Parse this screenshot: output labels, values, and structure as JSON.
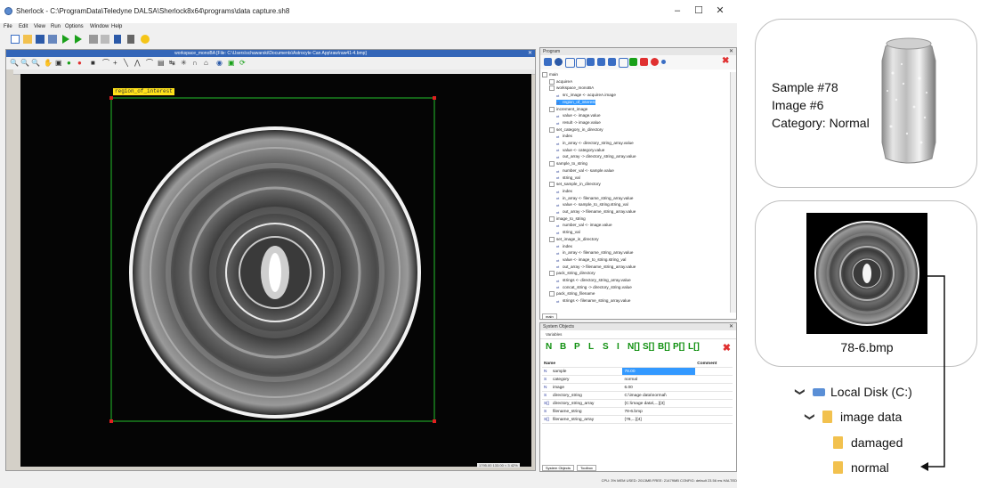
{
  "window": {
    "title": "Sherlock - C:\\ProgramData\\Teledyne DALSA\\Sherlock8x64\\programs\\data capture.sh8",
    "minimize": "–",
    "maximize": "☐",
    "close": "✕"
  },
  "menu": [
    "File",
    "Edit",
    "View",
    "Run",
    "Options",
    "Window",
    "Help"
  ],
  "image_window": {
    "title": "workspace_monoBA [File: C:\\Users\\schawarski\\Documents\\Astrocyte Can App\\raw\\raw41-4.bmp]",
    "roi_label": "region_of_interest",
    "status": "1795.00 133.00 < 3  42%"
  },
  "program": {
    "title": "Program",
    "tab": "main",
    "tree": [
      {
        "indent": 0,
        "label": "main"
      },
      {
        "indent": 1,
        "label": "acquireA"
      },
      {
        "indent": 1,
        "label": "workspace_monoBA"
      },
      {
        "indent": 2,
        "label": "src_image <- acquireA.image"
      },
      {
        "indent": 2,
        "label": "region_of_interest",
        "selected": true
      },
      {
        "indent": 1,
        "label": "increment_image"
      },
      {
        "indent": 2,
        "label": "value <- image.value"
      },
      {
        "indent": 2,
        "label": "result -> image.value"
      },
      {
        "indent": 1,
        "label": "set_category_in_directory"
      },
      {
        "indent": 2,
        "label": "index"
      },
      {
        "indent": 2,
        "label": "in_array <- directory_string_array.value"
      },
      {
        "indent": 2,
        "label": "value <- category.value"
      },
      {
        "indent": 2,
        "label": "out_array -> directory_string_array.value"
      },
      {
        "indent": 1,
        "label": "sample_to_string"
      },
      {
        "indent": 2,
        "label": "number_val <- sample.value"
      },
      {
        "indent": 2,
        "label": "string_val"
      },
      {
        "indent": 1,
        "label": "set_sample_in_directory"
      },
      {
        "indent": 2,
        "label": "index"
      },
      {
        "indent": 2,
        "label": "in_array <- filename_string_array.value"
      },
      {
        "indent": 2,
        "label": "value <- sample_to_string.string_val"
      },
      {
        "indent": 2,
        "label": "out_array -> filename_string_array.value"
      },
      {
        "indent": 1,
        "label": "image_to_string"
      },
      {
        "indent": 2,
        "label": "number_val <- image.value"
      },
      {
        "indent": 2,
        "label": "string_val"
      },
      {
        "indent": 1,
        "label": "set_image_in_directory"
      },
      {
        "indent": 2,
        "label": "index"
      },
      {
        "indent": 2,
        "label": "in_array <- filename_string_array.value"
      },
      {
        "indent": 2,
        "label": "value <- image_to_string.string_val"
      },
      {
        "indent": 2,
        "label": "out_array -> filename_string_array.value"
      },
      {
        "indent": 1,
        "label": "pack_string_directory"
      },
      {
        "indent": 2,
        "label": "strings <- directory_string_array.value"
      },
      {
        "indent": 2,
        "label": "concat_string -> directory_string.value"
      },
      {
        "indent": 1,
        "label": "pack_string_filename"
      },
      {
        "indent": 2,
        "label": "strings <- filename_string_array.value"
      }
    ]
  },
  "system_objects": {
    "title": "System Objects",
    "dropdown": "Variables",
    "type_buttons": [
      "N",
      "B",
      "P",
      "L",
      "S",
      "I",
      "N[]",
      "S[]",
      "B[]",
      "P[]",
      "L[]"
    ],
    "delete": "✖",
    "headers": [
      "Name",
      "",
      "Comment"
    ],
    "rows": [
      {
        "type": "N",
        "name": "sample",
        "value": "78.00",
        "selected": true
      },
      {
        "type": "S",
        "name": "category",
        "value": "normal"
      },
      {
        "type": "N",
        "name": "image",
        "value": "6.00"
      },
      {
        "type": "S",
        "name": "directory_string",
        "value": "C:\\image data\\normal\\"
      },
      {
        "type": "S[]",
        "name": "directory_string_array",
        "value": "{C:\\image data\\,...}[3]"
      },
      {
        "type": "S",
        "name": "filename_string",
        "value": "78-6.bmp"
      },
      {
        "type": "S[]",
        "name": "filename_string_array",
        "value": "{78,...}[4]"
      }
    ],
    "tabs": [
      "System Objects",
      "Toolbox"
    ]
  },
  "statusbar": "CPU: 3%  MEM USED: 2013MB  FREE: 21479MB  CONFIG: default  23.56 ms  HALTED",
  "annotation": {
    "sample_line": "Sample #78",
    "image_line": "Image #6",
    "category_line": "Category: Normal",
    "file_caption": "78-6.bmp",
    "folders": [
      {
        "label": "Local Disk (C:)",
        "expanded": true
      },
      {
        "label": "image data",
        "expanded": true
      },
      {
        "label": "damaged"
      },
      {
        "label": "normal"
      }
    ]
  },
  "colors": {
    "accent": "#3466b8",
    "roi_box": "#22c02a",
    "roi_label": "#ffe21a",
    "folder": "#f2c14e",
    "selection": "#3399ff"
  }
}
